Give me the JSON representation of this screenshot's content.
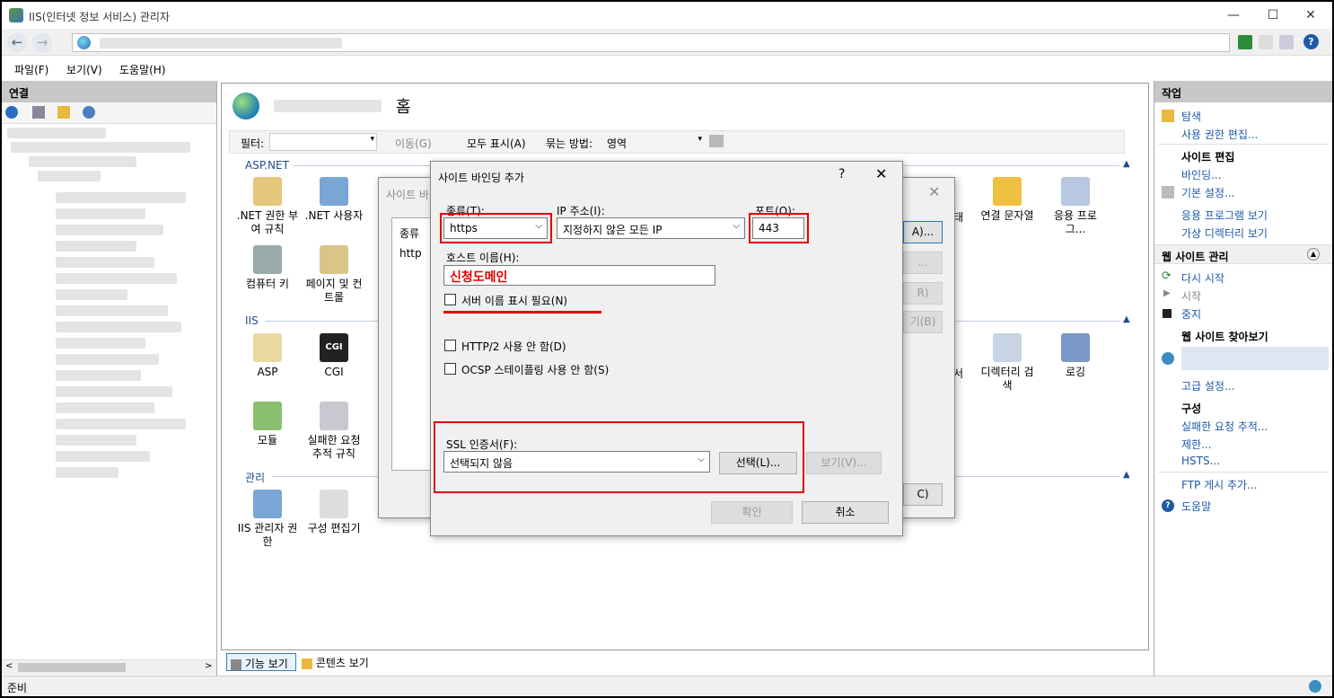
{
  "window": {
    "title": "IIS(인터넷 정보 서비스) 관리자"
  },
  "menu": [
    "파일(F)",
    "보기(V)",
    "도움말(H)"
  ],
  "left_pane": {
    "header": "연결"
  },
  "center": {
    "title": "홈",
    "filter_label": "필터:",
    "go_label": "이동(G)",
    "show_all_label": "모두 표시(A)",
    "group_by_label": "묶는 방법:",
    "group_by_value": "영역",
    "sections": {
      "aspnet": "ASP.NET",
      "iis": "IIS",
      "mgmt": "관리"
    },
    "tiles": {
      "net_auth": ".NET 권한 부여 규칙",
      "net_users": ".NET 사용자",
      "machine_key": "컴퓨터 키",
      "pages_controls": "페이지 및 컨트롤",
      "conn_strings": "연결 문자열",
      "app_settings": "응용 프로그...",
      "asp": "ASP",
      "cgi": "CGI",
      "dir_browse": "디렉터리 검색",
      "logging": "로깅",
      "modules": "모듈",
      "failed_req": "실패한 요청 추적 규칙",
      "iis_mgr_perm": "IIS 관리자 권한",
      "config_editor": "구성 편집기",
      "partial_te": "태",
      "partial_seo": "서"
    },
    "bottom_tabs": {
      "features": "기능 보기",
      "content": "콘텐츠 보기"
    }
  },
  "bg_dialog": {
    "title": "사이트 바",
    "col_type": "종류",
    "row_type": "http",
    "btn_add": "A)...",
    "btn_edit": "...",
    "btn_remove": "R)",
    "btn_browse": "기(B)",
    "btn_close": "C)"
  },
  "dialog": {
    "title": "사이트 바인딩 추가",
    "help": "?",
    "close": "✕",
    "type_label": "종류(T):",
    "type_value": "https",
    "ip_label": "IP 주소(I):",
    "ip_value": "지정하지 않은 모든 IP",
    "port_label": "포트(O):",
    "port_value": "443",
    "host_label": "호스트 이름(H):",
    "host_value": "신청도메인",
    "sni_label": "서버 이름 표시 필요(N)",
    "http2_label": "HTTP/2 사용 안 함(D)",
    "ocsp_label": "OCSP 스테이플링 사용 안 함(S)",
    "ssl_label": "SSL 인증서(F):",
    "ssl_value": "선택되지 않음",
    "select_btn": "선택(L)...",
    "view_btn": "보기(V)...",
    "ok_btn": "확인",
    "cancel_btn": "취소"
  },
  "right_pane": {
    "header": "작업",
    "explore": "탐색",
    "edit_perms": "사용 권한 편집...",
    "site_edit_head": "사이트 편집",
    "bindings": "바인딩...",
    "basic_settings": "기본 설정...",
    "view_apps": "응용 프로그램 보기",
    "view_vdirs": "가상 디렉터리 보기",
    "manage_head": "웹 사이트 관리",
    "restart": "다시 시작",
    "start": "시작",
    "stop": "중지",
    "browse_head": "웹 사이트 찾아보기",
    "advanced": "고급 설정...",
    "config_head": "구성",
    "failed_trace": "실패한 요청 추적...",
    "limits": "제한...",
    "hsts": "HSTS...",
    "ftp_publish": "FTP 게시 추가...",
    "help": "도움말"
  },
  "status": {
    "text": "준비"
  },
  "colors": {
    "highlight": "#e00000",
    "link": "#1e5aa8",
    "section": "#1e4e8c"
  }
}
